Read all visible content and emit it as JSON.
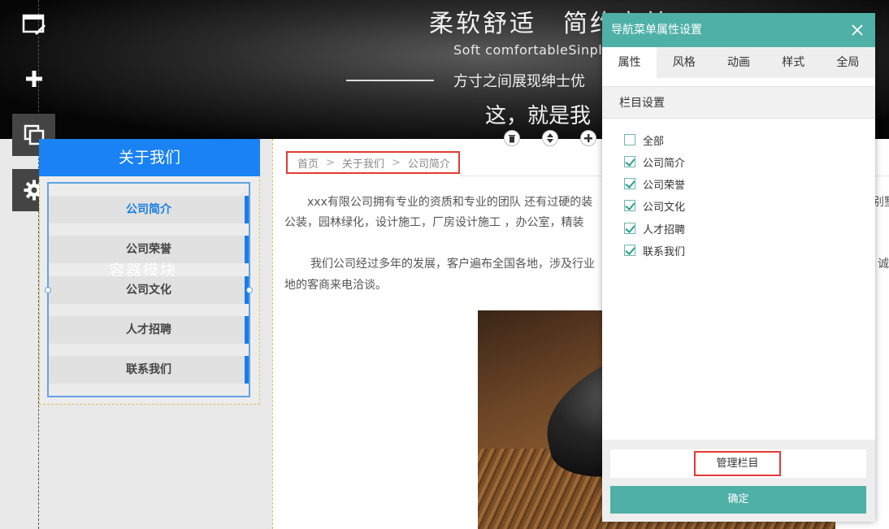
{
  "banner": {
    "title": "柔软舒适　简约完美",
    "subtitle": "Soft comfortableSinple",
    "tagline": "方寸之间展现绅士优",
    "slogan": "这，就是我"
  },
  "toolbar": {
    "items": [
      "window-edit-icon",
      "plus-icon",
      "copy-icon",
      "gear-icon"
    ]
  },
  "sidebar": {
    "header": "关于我们",
    "watermark": "容器模块",
    "items": [
      {
        "label": "公司简介",
        "active": true
      },
      {
        "label": "公司荣誉",
        "active": false
      },
      {
        "label": "公司文化",
        "active": false
      },
      {
        "label": "人才招聘",
        "active": false
      },
      {
        "label": "联系我们",
        "active": false
      }
    ]
  },
  "breadcrumb": {
    "home": "首页",
    "parent": "关于我们",
    "current": "公司简介",
    "separator": ">"
  },
  "content": {
    "para1_line1": "xxx有限公司拥有专业的资质和专业的团队 还有过硬的装",
    "para1_line1_right": "别墅",
    "para1_line2": "公装，园林绿化，设计施工，厂房设计施工 ，办公室，精装",
    "para2_line1": "我们公司经过多年的发展，客户遍布全国各地，涉及行业",
    "para2_line1_right": "诚",
    "para2_line2": "地的客商来电洽谈。"
  },
  "module_controls": [
    "trash-icon",
    "sort-icon",
    "plus-icon"
  ],
  "dialog": {
    "title": "导航菜单属性设置",
    "tabs": [
      {
        "label": "属性",
        "active": true
      },
      {
        "label": "风格",
        "active": false
      },
      {
        "label": "动画",
        "active": false
      },
      {
        "label": "样式",
        "active": false
      },
      {
        "label": "全局",
        "active": false
      }
    ],
    "section_title": "栏目设置",
    "checkboxes": [
      {
        "label": "全部",
        "checked": false
      },
      {
        "label": "公司简介",
        "checked": true
      },
      {
        "label": "公司荣誉",
        "checked": true
      },
      {
        "label": "公司文化",
        "checked": true
      },
      {
        "label": "人才招聘",
        "checked": true
      },
      {
        "label": "联系我们",
        "checked": true
      }
    ],
    "manage_label": "管理栏目",
    "confirm_label": "确定"
  },
  "colors": {
    "accent_blue": "#1a82f4",
    "dialog_teal": "#4fb0a7",
    "highlight_red": "#e53935"
  }
}
